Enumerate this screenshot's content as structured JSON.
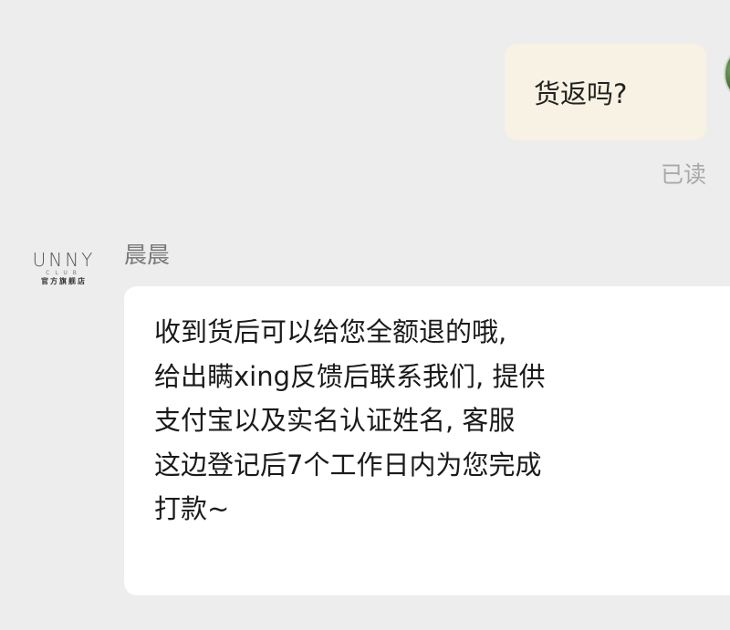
{
  "outgoing_message": {
    "text": "货返吗?",
    "status": "已读"
  },
  "incoming_message": {
    "sender_name": "晨晨",
    "avatar_logo": {
      "wordmark": "UNNY",
      "club": "CLUB",
      "subtitle": "官方旗舰店"
    },
    "lines": [
      "收到货后可以给您全额退的哦,",
      "给出瞒xing反馈后联系我们, 提供",
      "支付宝以及实名认证姓名, 客服",
      "这边登记后7个工作日内为您完成",
      "打款~"
    ]
  }
}
